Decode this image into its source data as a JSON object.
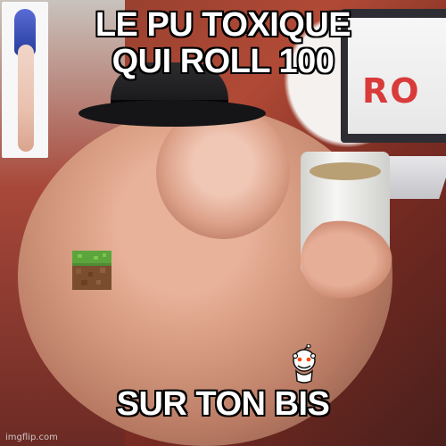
{
  "meme": {
    "top_text_line1": "LE PU TOXIQUE",
    "top_text_line2": "QUI ROLL 100",
    "bottom_text": "SUR TON BIS",
    "watermark": "imgflip.com"
  },
  "background_scene": {
    "monitor_text": "RO"
  },
  "icons": {
    "minecraft": "minecraft-grass-block-icon",
    "reddit": "reddit-snoo-icon",
    "hat": "fedora-hat-icon"
  },
  "colors": {
    "text": "#ffffff",
    "text_outline": "#000000",
    "background": "#8d3b2c",
    "accent": "#d93a3a"
  }
}
